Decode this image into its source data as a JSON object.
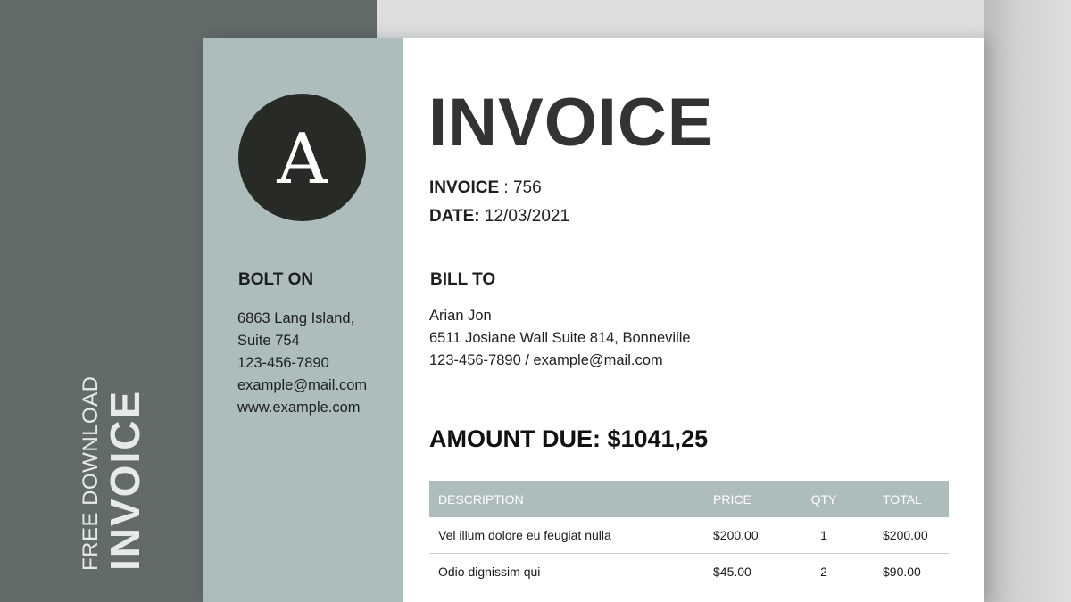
{
  "side": {
    "small": "FREE DOWNLOAD",
    "big": "INVOICE"
  },
  "logo": {
    "letter": "A"
  },
  "company": {
    "name": "BOLT ON",
    "lines": [
      "6863 Lang Island,",
      "Suite 754",
      "123-456-7890",
      "example@mail.com",
      "www.example.com"
    ]
  },
  "invoice": {
    "title": "INVOICE",
    "number_label": "INVOICE",
    "number_sep": " : ",
    "number": "756",
    "date_label": "DATE:",
    "date": "12/03/2021"
  },
  "bill_to": {
    "heading": "BILL TO",
    "lines": [
      "Arian Jon",
      "6511 Josiane Wall Suite 814, Bonneville",
      "123-456-7890 / example@mail.com"
    ]
  },
  "amount_due": "AMOUNT DUE: $1041,25",
  "table": {
    "headers": {
      "description": "DESCRIPTION",
      "price": "PRICE",
      "qty": "QTY",
      "total": "TOTAL"
    },
    "rows": [
      {
        "description": "Vel illum dolore eu feugiat nulla",
        "price": "$200.00",
        "qty": "1",
        "total": "$200.00"
      },
      {
        "description": "Odio dignissim qui",
        "price": "$45.00",
        "qty": "2",
        "total": "$90.00"
      }
    ]
  },
  "colors": {
    "dark_panel": "#626a6a",
    "sage": "#adbdbc",
    "logo_circle": "#272a25"
  }
}
